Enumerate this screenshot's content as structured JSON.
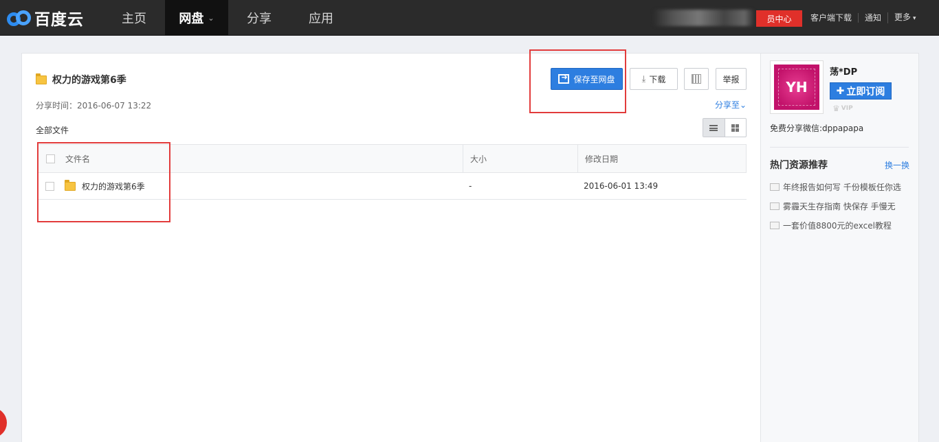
{
  "brand": {
    "name": "百度云"
  },
  "nav": {
    "items": [
      {
        "label": "主页"
      },
      {
        "label": "网盘"
      },
      {
        "label": "分享"
      },
      {
        "label": "应用"
      }
    ]
  },
  "top_links": {
    "vip_center": "员中心",
    "client_download": "客户端下载",
    "notify": "通知",
    "more": "更多"
  },
  "share": {
    "title": "权力的游戏第6季",
    "share_time": "分享时间：2016-06-07 13:22",
    "all_files": "全部文件",
    "share_to": "分享至"
  },
  "toolbar": {
    "save_label": "保存至网盘",
    "download_label": "下载",
    "report_label": "举报"
  },
  "table": {
    "headers": {
      "name": "文件名",
      "size": "大小",
      "date": "修改日期"
    },
    "rows": [
      {
        "name": "权力的游戏第6季",
        "size": "-",
        "date": "2016-06-01 13:49"
      }
    ]
  },
  "user": {
    "avatar_text": "YH",
    "name": "荡*DP",
    "subscribe_label": "立即订阅",
    "vip_label": "VIP",
    "wechat": "免费分享微信:dppapapa"
  },
  "hot": {
    "title": "热门资源推荐",
    "switch_label": "换一换",
    "items": [
      "年终报告如何写 千份模板任你选",
      "雾霾天生存指南 快保存 手慢无",
      "一套价值8800元的excel教程"
    ]
  },
  "colors": {
    "accent": "#2d7ee0",
    "highlight": "#e23b3b",
    "vip_red": "#e0302a"
  },
  "icons": {
    "folder": "folder-icon",
    "download": "download-icon",
    "qrcode": "qrcode-icon",
    "list_view": "list-view-icon",
    "grid_view": "grid-view-icon",
    "document": "document-icon"
  }
}
